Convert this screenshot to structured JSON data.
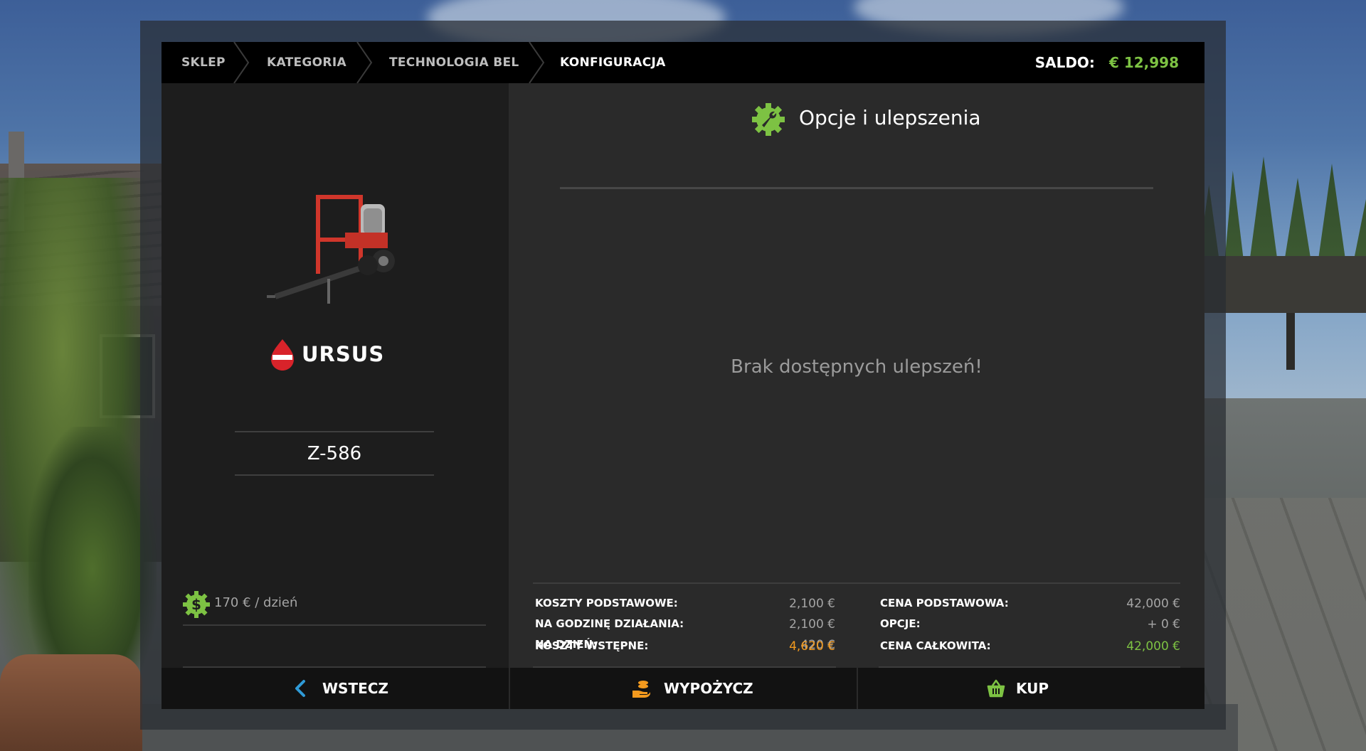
{
  "breadcrumb": {
    "items": [
      "SKLEP",
      "KATEGORIA",
      "TECHNOLOGIA BEL",
      "KONFIGURACJA"
    ]
  },
  "balance": {
    "label": "SALDO:",
    "value": "€ 12,998"
  },
  "vehicle": {
    "brand": "URSUS",
    "brand_logo_text": "URSUS",
    "model": "Z-586",
    "rent_price": "170 € / dzień"
  },
  "options": {
    "title": "Opcje i ulepszenia",
    "empty_message": "Brak dostępnych ulepszeń!"
  },
  "costs": {
    "left": [
      {
        "label": "KOSZTY PODSTAWOWE:",
        "value": "2,100 €"
      },
      {
        "label": "NA GODZINĘ DZIAŁANIA:",
        "value": "2,100 €"
      },
      {
        "label": "NA DZIEŃ:",
        "value": "420 €"
      }
    ],
    "left_total": {
      "label": "KOSZTY WSTĘPNE:",
      "value": "4,620 €"
    },
    "right": [
      {
        "label": "CENA PODSTAWOWA:",
        "value": "42,000 €"
      },
      {
        "label": "OPCJE:",
        "value": "+ 0 €"
      }
    ],
    "right_total": {
      "label": "CENA CAŁKOWITA:",
      "value": "42,000 €"
    }
  },
  "buttons": {
    "back": "WSTECZ",
    "lease": "WYPOŻYCZ",
    "buy": "KUP"
  },
  "colors": {
    "accent_green": "#7dc243",
    "accent_orange": "#f39a1e",
    "accent_blue": "#2f9ad6",
    "brand_red": "#d8232a"
  },
  "icons": {
    "options": "wrench-gear-icon",
    "rent": "dollar-gear-icon",
    "back": "chevron-left-icon",
    "lease": "hand-coins-icon",
    "buy": "basket-icon"
  }
}
